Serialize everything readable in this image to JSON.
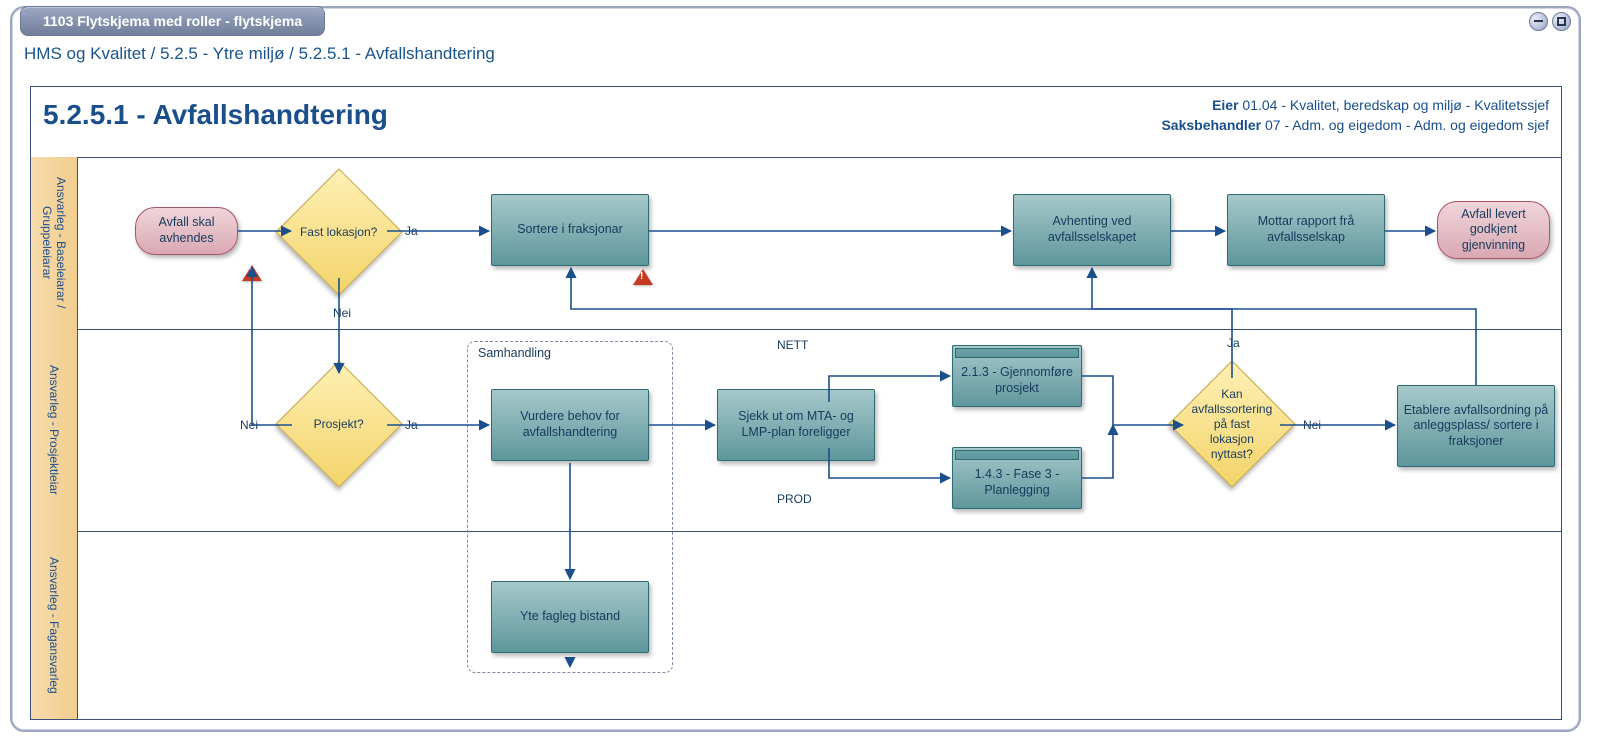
{
  "window": {
    "title": "1103 Flytskjema med roller - flytskjema"
  },
  "breadcrumb": {
    "part1": "HMS og Kvalitet",
    "sep": " / ",
    "part2": "5.2.5 - Ytre miljø",
    "part3": "5.2.5.1 - Avfallshandtering"
  },
  "header": {
    "title": "5.2.5.1 - Avfallshandtering",
    "owner_label": "Eier",
    "owner_value": " 01.04 - Kvalitet, beredskap og miljø - Kvalitetssjef",
    "caseworker_label": "Saksbehandler",
    "caseworker_value": " 07 - Adm. og eigedom - Adm. og eigedom sjef"
  },
  "lanes": [
    {
      "id": "lane1",
      "label": "Ansvarleg - Baseleiarar / Gruppeleiarar"
    },
    {
      "id": "lane2",
      "label": "Ansvarleg - Prosjektleiar"
    },
    {
      "id": "lane3",
      "label": "Ansvarleg - Fagansvarleg"
    }
  ],
  "nodes": {
    "start": "Avfall skal avhendes",
    "d_fast": "Fast lokasjon?",
    "p_sortere": "Sortere i fraksjonar",
    "p_avhenting": "Avhenting ved avfallsselskapet",
    "p_rapport": "Mottar rapport frå avfallsselskap",
    "end": "Avfall levert godkjent gjenvinning",
    "d_prosjekt": "Prosjekt?",
    "p_vurdere": "Vurdere behov for avfallshandtering",
    "p_sjekk": "Sjekk ut om MTA- og LMP-plan foreligger",
    "sp_213": "2.1.3 - Gjennomføre prosjekt",
    "sp_143": "1.4.3 - Fase 3 - Planlegging",
    "d_sortfast": "Kan avfallssortering på fast lokasjon nyttast?",
    "p_etablere": "Etablere avfallsordning på anleggsplass/ sortere i fraksjoner",
    "p_yte": "Yte fagleg bistand",
    "group_title": "Samhandling"
  },
  "edge_labels": {
    "ja": "Ja",
    "nei": "Nei",
    "nett": "NETT",
    "prod": "PROD"
  }
}
